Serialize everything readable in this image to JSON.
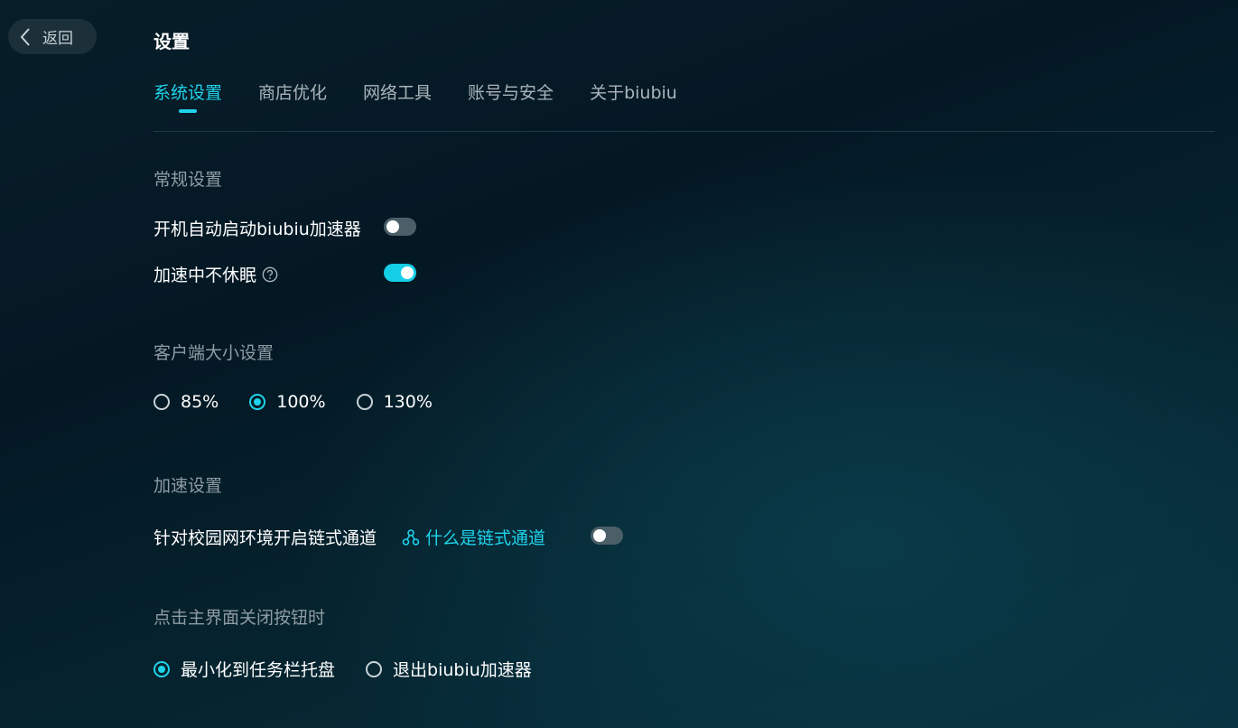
{
  "header": {
    "back_label": "返回",
    "title": "设置"
  },
  "tabs": [
    {
      "label": "系统设置",
      "active": true
    },
    {
      "label": "商店优化",
      "active": false
    },
    {
      "label": "网络工具",
      "active": false
    },
    {
      "label": "账号与安全",
      "active": false
    },
    {
      "label": "关于biubiu",
      "active": false
    }
  ],
  "general": {
    "title": "常规设置",
    "autostart": {
      "label": "开机自动启动biubiu加速器",
      "enabled": false
    },
    "no_sleep": {
      "label": "加速中不休眠",
      "enabled": true,
      "help_icon": "question-circle-icon"
    }
  },
  "client_size": {
    "title": "客户端大小设置",
    "options": [
      "85%",
      "100%",
      "130%"
    ],
    "selected": "100%"
  },
  "acceleration": {
    "title": "加速设置",
    "chain": {
      "label": "针对校园网环境开启链式通道",
      "link": "什么是链式通道",
      "link_icon": "chain-nodes-icon",
      "enabled": false
    }
  },
  "close_behavior": {
    "title": "点击主界面关闭按钮时",
    "options": [
      "最小化到任务栏托盘",
      "退出biubiu加速器"
    ],
    "selected": "最小化到任务栏托盘"
  },
  "colors": {
    "accent": "#1fd3ea",
    "toggle_off": "#4b5f68",
    "muted_text": "#8f9ca4"
  }
}
